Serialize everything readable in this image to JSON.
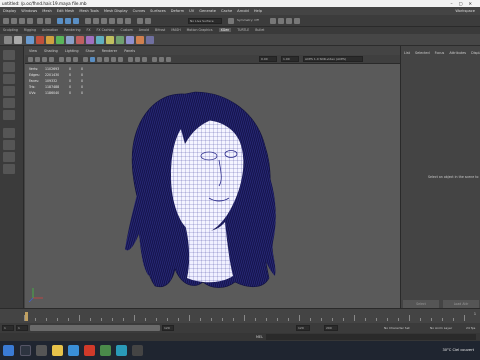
{
  "titlebar": {
    "title": "untitled: /p.oc/fhnd.hair.19.maya file.mb"
  },
  "menubar": {
    "items": [
      "Display",
      "Windows",
      "Mesh",
      "Edit Mesh",
      "Mesh Tools",
      "Mesh Display",
      "Curves",
      "Surfaces",
      "Deform",
      "UV",
      "Generate",
      "Cache",
      "Arnold",
      "Help"
    ],
    "workspace": "Workspace"
  },
  "statusline": {
    "target_field": "No Live Surface",
    "symmetry": "Symmetry: Off"
  },
  "shelftabs": [
    "Sculpting",
    "Rigging",
    "Animation",
    "Rendering",
    "FX",
    "FX Caching",
    "Custom",
    "Arnold",
    "Bifrost",
    "MASH",
    "Motion Graphics",
    "XGen",
    "TURTLE",
    "Bullet"
  ],
  "shelftab_active": "XGen",
  "panel": {
    "menu": [
      "View",
      "Shading",
      "Lighting",
      "Show",
      "Renderer",
      "Panels"
    ],
    "camera_value": "0.00",
    "scale_value": "1.00",
    "colorspace": "ACES 1.0 SDR-video (ACES)"
  },
  "hud": {
    "rows": [
      {
        "label": "Verts:",
        "value": "1102693",
        "a": "0",
        "b": "0"
      },
      {
        "label": "Edges:",
        "value": "2201430",
        "a": "0",
        "b": "0"
      },
      {
        "label": "Faces:",
        "value": "109332",
        "a": "0",
        "b": "0"
      },
      {
        "label": "Tris:",
        "value": "1187488",
        "a": "0",
        "b": "0"
      },
      {
        "label": "UVs:",
        "value": "1186040",
        "a": "0",
        "b": "0"
      }
    ]
  },
  "rightpanel": {
    "tabs": [
      "List",
      "Selected",
      "Focus",
      "Attributes",
      "Display"
    ],
    "message": "Select an object in the scene to",
    "select_btn": "Select",
    "load_btn": "Load Attr"
  },
  "timeslider": {
    "current_frame": "1"
  },
  "rangebar": {
    "start": "1",
    "start2": "1",
    "mid_value": "120",
    "end_value": "120",
    "end_value2": "200",
    "char_set": "No Character Set",
    "anim_layer": "No Anim Layer",
    "fps": "24 fps"
  },
  "cmdline": {
    "label": "MEL"
  },
  "taskbar": {
    "weather": "30°C  Ciel couvert",
    "time": "14:32",
    "date": "2023-06-14"
  }
}
